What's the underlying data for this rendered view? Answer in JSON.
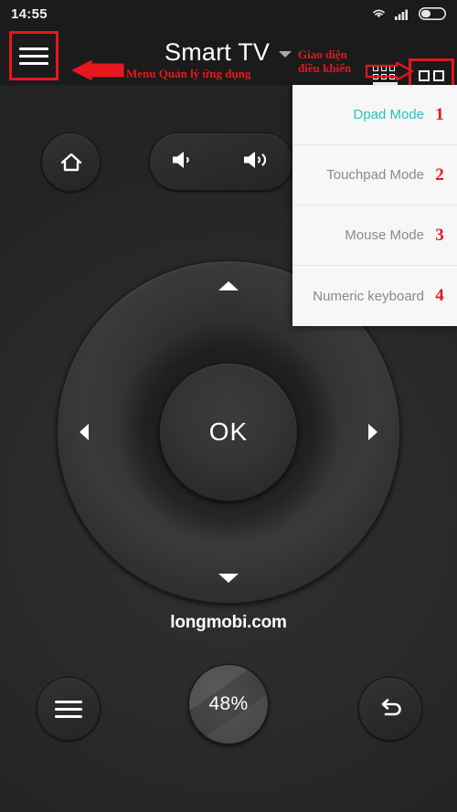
{
  "statusbar": {
    "time": "14:55",
    "icons": [
      "wifi-icon",
      "signal-icon",
      "battery-icon"
    ]
  },
  "topbar": {
    "menu_icon": "hamburger-icon",
    "title": "Smart TV",
    "chevron_icon": "chevron-down-icon",
    "keyboard_icon": "keyboard-icon",
    "grid_icon": "grid-icon"
  },
  "annotations": {
    "left_text": "Menu Quản lý ứng dụng",
    "right_text_line1": "Giao diện",
    "right_text_line2": "điều khiển",
    "color": "#e8161d"
  },
  "remote": {
    "home_icon": "home-icon",
    "volume_down_icon": "volume-down-icon",
    "volume_up_icon": "volume-up-icon",
    "dpad": {
      "ok_label": "OK",
      "up_icon": "arrow-up-icon",
      "down_icon": "arrow-down-icon",
      "left_icon": "arrow-left-icon",
      "right_icon": "arrow-right-icon"
    },
    "watermark": "longmobi.com",
    "bottom": {
      "menu_icon": "hamburger-icon",
      "battery_percent": "48%",
      "back_icon": "back-arrow-icon"
    }
  },
  "dropdown": {
    "active_color": "#27c4bd",
    "items": [
      {
        "label": "Dpad Mode",
        "num": "1",
        "active": true
      },
      {
        "label": "Touchpad Mode",
        "num": "2",
        "active": false
      },
      {
        "label": "Mouse Mode",
        "num": "3",
        "active": false
      },
      {
        "label": "Numeric keyboard",
        "num": "4",
        "active": false
      }
    ]
  }
}
